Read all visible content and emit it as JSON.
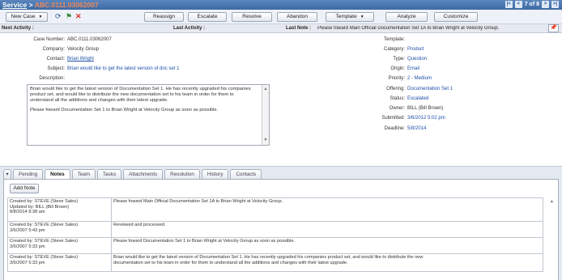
{
  "title": {
    "section": "Service",
    "separator": " > ",
    "case": "ABC.0111.03062007",
    "pager_first": "|<",
    "pager_prev": "<",
    "pager_text": "7 of 8",
    "pager_next": ">",
    "pager_last": ">|"
  },
  "toolbar": {
    "new_case": "New Case",
    "reassign": "Reassign",
    "escalate": "Escalate",
    "resolve": "Resolve",
    "abandon": "Abandon",
    "template": "Template",
    "analyze": "Analyze",
    "customize": "Customize"
  },
  "activity": {
    "next_label": "Next Activity :",
    "last_label": "Last Activity :",
    "last_note_label": "Last Note :",
    "last_note_value": "Please foward Main Official Documentation Set 1A to Brian Wright at Velocity Group."
  },
  "case": {
    "number_label": "Case Number:",
    "number": "ABC.0111.03062007",
    "company_label": "Company:",
    "company": "Velocity Group",
    "contact_label": "Contact:",
    "contact": "Brian Wright",
    "subject_label": "Subject:",
    "subject": "Brian would like to get the latest version of doc set 1",
    "description_label": "Description:",
    "description_p1": "Brian would like to get the latest version of Documentation Set 1. He has recently upgraded his companies product set, and would like to distribute the new documentation set to his team in order for them to understand all the additions and changes with their latest upgrade.",
    "description_p2": "Please foward Documentation Set 1 to Brian Wright at Velocity Group as soon as possible."
  },
  "details": {
    "template_label": "Template:",
    "template": "",
    "category_label": "Category:",
    "category": "Product",
    "type_label": "Type:",
    "type": "Question",
    "origin_label": "Origin:",
    "origin": "Email",
    "priority_label": "Priority:",
    "priority": "2 - Medium",
    "offering_label": "Offering:",
    "offering": "Documentation Set 1",
    "status_label": "Status:",
    "status": "Escalated",
    "owner_label": "Owner:",
    "owner": "BILL (Bill Brown)",
    "submitted_label": "Submitted:",
    "submitted": "3/6/2012 5:02 pm",
    "deadline_label": "Deadline:",
    "deadline": "5/8/2014"
  },
  "tabs": [
    "Pending",
    "Notes",
    "Team",
    "Tasks",
    "Attachments",
    "Resolution",
    "History",
    "Contacts"
  ],
  "notes": {
    "add_label": "Add Note",
    "rows": [
      {
        "meta_1": "Created by: STEVE (Steve Sales)",
        "meta_2": "Updated by: BILL (Bill Brown)",
        "meta_3": "8/8/2014 8:38 am",
        "text_1": "Please foward Main Official Documentation Set 1A to Brian Wright at Velocity Group.",
        "text_2": ""
      },
      {
        "meta_1": "Created by: STEVE (Steve Sales)",
        "meta_2": "3/6/2007 5:43 pm",
        "meta_3": "",
        "text_1": "Reviewed and processed.",
        "text_2": ""
      },
      {
        "meta_1": "Created by: STEVE (Steve Sales)",
        "meta_2": "3/6/2007 5:33 pm",
        "meta_3": "",
        "text_1": "Please foward Documentation Set 1 to Brian Wright at Velocity Group as soon as possible.",
        "text_2": ""
      },
      {
        "meta_1": "Created by: STEVE (Steve Sales)",
        "meta_2": "3/6/2007 5:33 pm",
        "meta_3": "",
        "text_1": "Brian would like to get the latest version of Documentation Set 1. He has recently upgraded his companies product set, and would like to distribute the new",
        "text_2": "documentation set to his team in order for them to understand all the additions and changes with their latest upgrade."
      }
    ]
  },
  "icons": {
    "refresh": "refresh-icon",
    "flag": "flag-icon",
    "delete": "delete-icon",
    "pin": "pin-icon"
  },
  "colors": {
    "titlebar": "#3e6aa4",
    "case_number": "#f08a5a",
    "link": "#1d4fa8",
    "delete": "#d9302a"
  }
}
